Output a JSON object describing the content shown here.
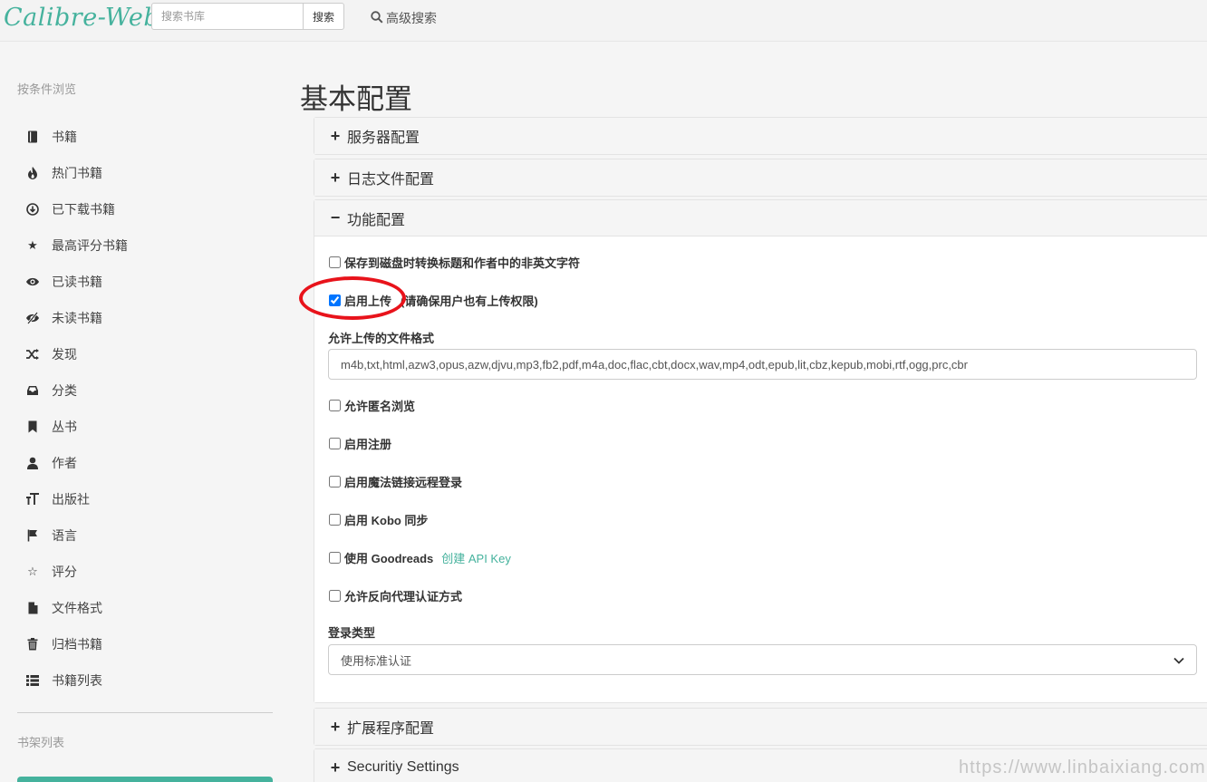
{
  "app": {
    "logo": "Calibre-Web"
  },
  "search": {
    "placeholder": "搜索书库",
    "button": "搜索",
    "advanced": "高级搜索"
  },
  "sidebar": {
    "heading": "按条件浏览",
    "items": [
      {
        "label": "书籍",
        "icon": "book-icon"
      },
      {
        "label": "热门书籍",
        "icon": "fire-icon"
      },
      {
        "label": "已下载书籍",
        "icon": "download-icon"
      },
      {
        "label": "最高评分书籍",
        "icon": "star-icon"
      },
      {
        "label": "已读书籍",
        "icon": "eye-icon"
      },
      {
        "label": "未读书籍",
        "icon": "eye-slash-icon"
      },
      {
        "label": "发现",
        "icon": "shuffle-icon"
      },
      {
        "label": "分类",
        "icon": "inbox-icon"
      },
      {
        "label": "丛书",
        "icon": "bookmark-icon"
      },
      {
        "label": "作者",
        "icon": "user-icon"
      },
      {
        "label": "出版社",
        "icon": "text-size-icon"
      },
      {
        "label": "语言",
        "icon": "flag-icon"
      },
      {
        "label": "评分",
        "icon": "star-outline-icon"
      },
      {
        "label": "文件格式",
        "icon": "file-icon"
      },
      {
        "label": "归档书籍",
        "icon": "trash-icon"
      },
      {
        "label": "书籍列表",
        "icon": "list-icon"
      }
    ],
    "shelves_heading": "书架列表"
  },
  "main": {
    "title": "基本配置",
    "panels": {
      "server": "服务器配置",
      "logfile": "日志文件配置",
      "feature": "功能配置",
      "extension": "扩展程序配置",
      "security": "Securitiy Settings"
    },
    "feature": {
      "unicode_filename": {
        "label": "保存到磁盘时转换标题和作者中的非英文字符",
        "checked": false
      },
      "uploading": {
        "label": "启用上传",
        "note": "(请确保用户也有上传权限)",
        "checked": true
      },
      "upload_formats_label": "允许上传的文件格式",
      "upload_formats_value": "m4b,txt,html,azw3,opus,azw,djvu,mp3,fb2,pdf,m4a,doc,flac,cbt,docx,wav,mp4,odt,epub,lit,cbz,kepub,mobi,rtf,ogg,prc,cbr",
      "anonbrowse": {
        "label": "允许匿名浏览",
        "checked": false
      },
      "public_reg": {
        "label": "启用注册",
        "checked": false
      },
      "remote_login": {
        "label": "启用魔法链接远程登录",
        "checked": false
      },
      "kobo_sync": {
        "label": "启用 Kobo 同步",
        "checked": false
      },
      "goodreads": {
        "label": "使用 Goodreads",
        "link": "创建 API Key",
        "checked": false
      },
      "reverse_proxy": {
        "label": "允许反向代理认证方式",
        "checked": false
      },
      "login_type_label": "登录类型",
      "login_type_value": "使用标准认证"
    }
  },
  "annotation": {
    "color": "#e8131b"
  },
  "watermark": "https://www.linbaixiang.com",
  "colors": {
    "accent": "#45b29d"
  }
}
